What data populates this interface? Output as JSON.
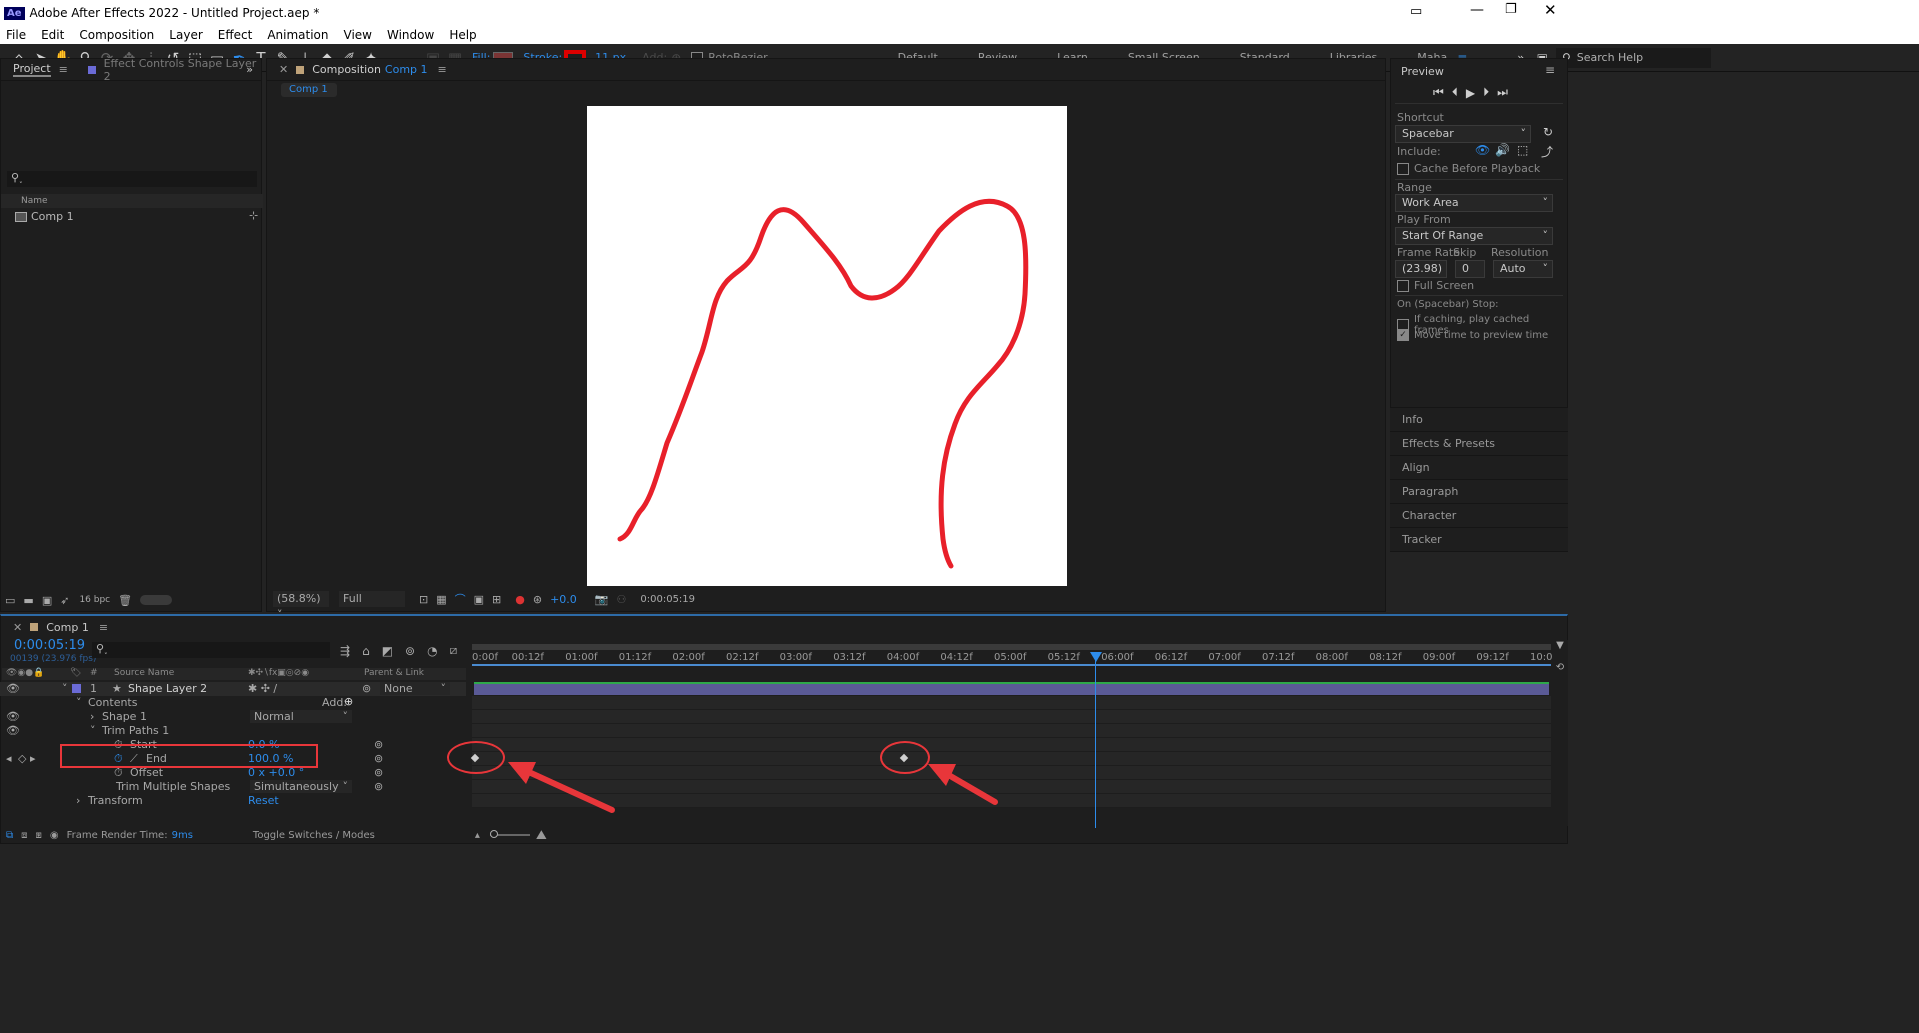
{
  "app": {
    "logo": "Ae",
    "title": "Adobe After Effects 2022 - Untitled Project.aep *"
  },
  "menu": [
    "File",
    "Edit",
    "Composition",
    "Layer",
    "Effect",
    "Animation",
    "View",
    "Window",
    "Help"
  ],
  "toolbar": {
    "fill_label": "Fill:",
    "stroke_label": "Stroke:",
    "stroke_px": "11 px",
    "add_label": "Add:",
    "rotobezier": "RotoBezier",
    "workspaces": [
      "Default",
      "Review",
      "Learn",
      "Small Screen",
      "Standard",
      "Libraries"
    ],
    "active_workspace": "Maha",
    "search_placeholder": "Search Help"
  },
  "project": {
    "tab_project": "Project",
    "tab_effects": "Effect Controls Shape Layer 2",
    "col_name": "Name",
    "items": [
      "Comp 1"
    ],
    "bpc": "16 bpc"
  },
  "comp": {
    "tab_label": "Composition",
    "comp_name": "Comp 1",
    "subtab": "Comp 1",
    "zoom": "(58.8%)",
    "resolution": "Full",
    "exposure": "+0.0",
    "timecode": "0:00:05:19"
  },
  "preview": {
    "title": "Preview",
    "shortcut_label": "Shortcut",
    "shortcut": "Spacebar",
    "include_label": "Include:",
    "cache_label": "Cache Before Playback",
    "range_label": "Range",
    "range": "Work Area",
    "play_from_label": "Play From",
    "play_from": "Start Of Range",
    "frame_rate_label": "Frame Rate",
    "skip_label": "Skip",
    "resolution_label": "Resolution",
    "frame_rate": "(23.98)",
    "skip": "0",
    "resolution": "Auto",
    "full_screen": "Full Screen",
    "stop_label": "On (Spacebar) Stop:",
    "if_caching": "If caching, play cached frames",
    "move_time": "Move time to preview time"
  },
  "side_panels": [
    "Info",
    "Effects & Presets",
    "Align",
    "Paragraph",
    "Character",
    "Tracker"
  ],
  "timeline": {
    "tab": "Comp 1",
    "time": "0:00:05:19",
    "fps": "00139 (23.976 fps)",
    "col_source": "Source Name",
    "col_parent": "Parent & Link",
    "layer_num": "1",
    "layer_name": "Shape Layer 2",
    "parent": "None",
    "contents": "Contents",
    "add_label": "Add:",
    "shape1": "Shape 1",
    "blend": "Normal",
    "trim": "Trim Paths 1",
    "start_label": "Start",
    "start_val": "0.0 %",
    "end_label": "End",
    "end_val": "100.0 %",
    "offset_label": "Offset",
    "offset_val": "0 x +0.0 °",
    "trim_multi": "Trim Multiple Shapes",
    "trim_multi_val": "Simultaneously",
    "transform": "Transform",
    "reset": "Reset",
    "render_time_label": "Frame Render Time:",
    "render_time": "9ms",
    "toggle": "Toggle Switches / Modes",
    "ruler": [
      "0:00f",
      "00:12f",
      "01:00f",
      "01:12f",
      "02:00f",
      "02:12f",
      "03:00f",
      "03:12f",
      "04:00f",
      "04:12f",
      "05:00f",
      "05:12f",
      "06:00f",
      "06:12f",
      "07:00f",
      "07:12f",
      "08:00f",
      "08:12f",
      "09:00f",
      "09:12f",
      "10:0"
    ]
  },
  "colors": {
    "accent": "#2d8ceb",
    "highlight": "#e8363a",
    "layer_bar": "#5a5a96"
  }
}
